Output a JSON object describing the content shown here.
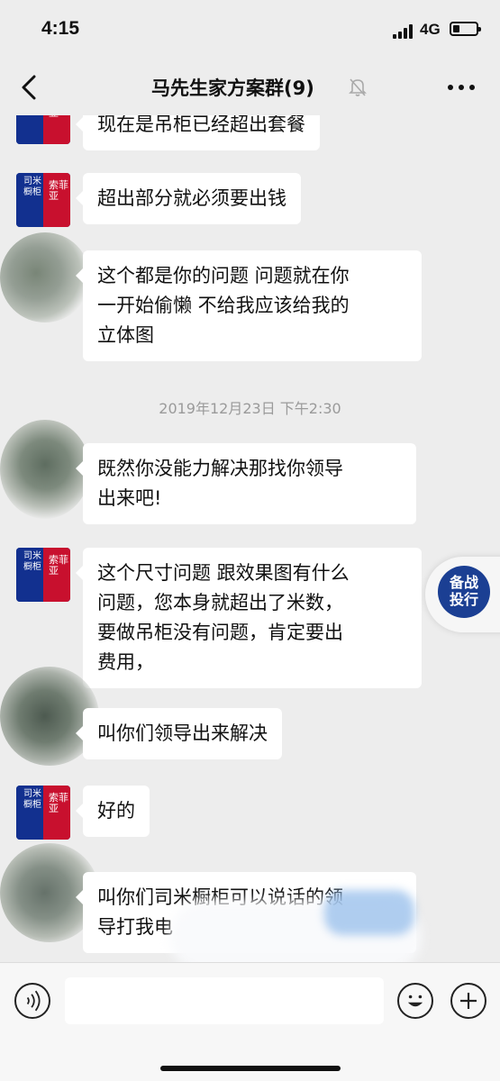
{
  "status_bar": {
    "time": "4:15",
    "network": "4G"
  },
  "nav": {
    "title": "马先生家方案群(9)"
  },
  "avatar_brand": {
    "left_text": "司米橱柜",
    "right_text": "索菲亚"
  },
  "messages": [
    {
      "sender": "brand",
      "text": "现在是吊柜已经超出套餐"
    },
    {
      "sender": "brand",
      "text": "超出部分就必须要出钱"
    },
    {
      "sender": "customer",
      "line1": "这个都是你的问题 问题就在你",
      "line2": "一开始偷懒 不给我应该给我的",
      "line3": "立体图"
    },
    {
      "sender": "customer",
      "line1": "既然你没能力解决那找你领导",
      "line2": "出来吧!"
    },
    {
      "sender": "brand",
      "line1": "这个尺寸问题 跟效果图有什么",
      "line2": "问题，您本身就超出了米数，",
      "line3": "要做吊柜没有问题，肯定要出",
      "line4": "费用，"
    },
    {
      "sender": "customer",
      "text": "叫你们领导出来解决"
    },
    {
      "sender": "brand",
      "text": "好的"
    },
    {
      "sender": "customer",
      "line1": "叫你们司米橱柜可以说话的领",
      "line2": "导打我电"
    }
  ],
  "timestamp": "2019年12月23日 下午2:30",
  "float_widget": {
    "line1": "备战",
    "line2": "投行"
  },
  "colors": {
    "background": "#ededed",
    "bubble": "#ffffff",
    "brand_blue": "#12308f",
    "brand_red": "#c8102e"
  },
  "icons": [
    "back-icon",
    "mute-icon",
    "more-icon",
    "voice-icon",
    "emoji-icon",
    "plus-icon"
  ]
}
